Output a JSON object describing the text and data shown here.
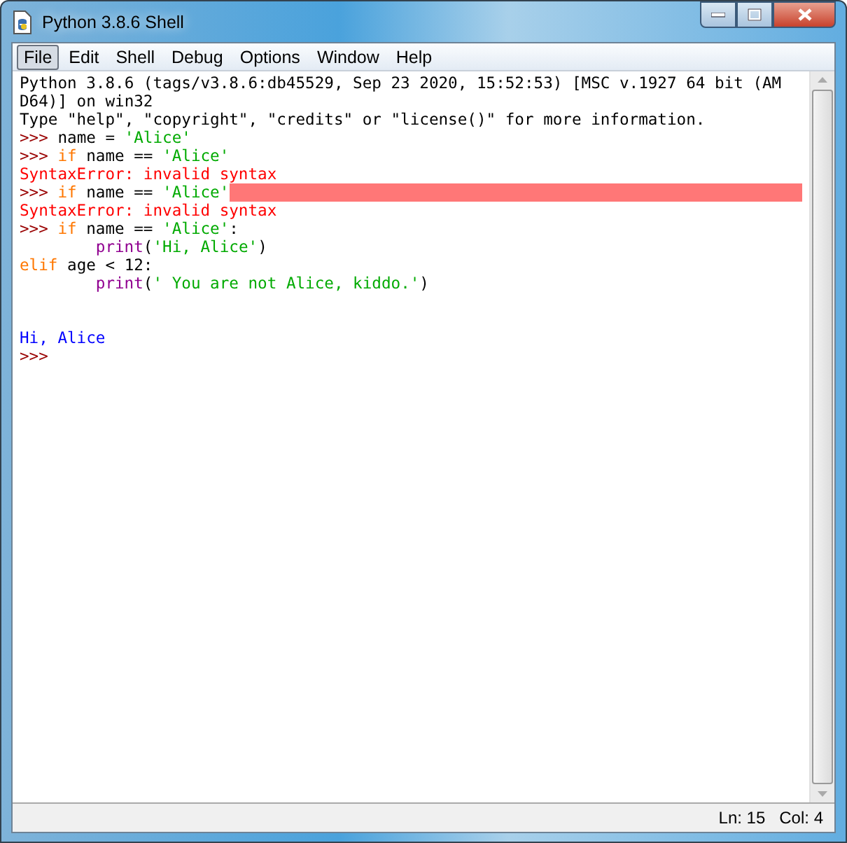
{
  "window": {
    "title": "Python 3.8.6 Shell"
  },
  "menu": [
    {
      "label": "File",
      "selected": true
    },
    {
      "label": "Edit",
      "selected": false
    },
    {
      "label": "Shell",
      "selected": false
    },
    {
      "label": "Debug",
      "selected": false
    },
    {
      "label": "Options",
      "selected": false
    },
    {
      "label": "Window",
      "selected": false
    },
    {
      "label": "Help",
      "selected": false
    }
  ],
  "lines": [
    {
      "segments": [
        {
          "kind": "plain",
          "text": "Python 3.8.6 (tags/v3.8.6:db45529, Sep 23 2020, 15:52:53) [MSC v.1927 64 bit (AM"
        }
      ]
    },
    {
      "segments": [
        {
          "kind": "plain",
          "text": "D64)] on win32"
        }
      ]
    },
    {
      "segments": [
        {
          "kind": "plain",
          "text": "Type \"help\", \"copyright\", \"credits\" or \"license()\" for more information."
        }
      ]
    },
    {
      "segments": [
        {
          "kind": "prompt",
          "text": ">>> "
        },
        {
          "kind": "plain",
          "text": "name = "
        },
        {
          "kind": "string",
          "text": "'Alice'"
        }
      ]
    },
    {
      "segments": [
        {
          "kind": "prompt",
          "text": ">>> "
        },
        {
          "kind": "keyword",
          "text": "if"
        },
        {
          "kind": "plain",
          "text": " name == "
        },
        {
          "kind": "string",
          "text": "'Alice'"
        }
      ]
    },
    {
      "segments": [
        {
          "kind": "error",
          "text": "SyntaxError: invalid syntax"
        }
      ]
    },
    {
      "segments": [
        {
          "kind": "prompt",
          "text": ">>> "
        },
        {
          "kind": "keyword",
          "text": "if"
        },
        {
          "kind": "plain",
          "text": " name == "
        },
        {
          "kind": "string",
          "text": "'Alice'"
        }
      ],
      "error_mark": true
    },
    {
      "segments": [
        {
          "kind": "error",
          "text": "SyntaxError: invalid syntax"
        }
      ]
    },
    {
      "segments": [
        {
          "kind": "prompt",
          "text": ">>> "
        },
        {
          "kind": "keyword",
          "text": "if"
        },
        {
          "kind": "plain",
          "text": " name == "
        },
        {
          "kind": "string",
          "text": "'Alice'"
        },
        {
          "kind": "plain",
          "text": ":"
        }
      ]
    },
    {
      "indented": true,
      "segments": [
        {
          "kind": "builtin",
          "text": "print"
        },
        {
          "kind": "plain",
          "text": "("
        },
        {
          "kind": "string",
          "text": "'Hi, Alice'"
        },
        {
          "kind": "plain",
          "text": ")"
        }
      ]
    },
    {
      "segments": [
        {
          "kind": "keyword",
          "text": "elif"
        },
        {
          "kind": "plain",
          "text": " age < 12:"
        }
      ]
    },
    {
      "indented": true,
      "segments": [
        {
          "kind": "builtin",
          "text": "print"
        },
        {
          "kind": "plain",
          "text": "("
        },
        {
          "kind": "string",
          "text": "' You are not Alice, kiddo.'"
        },
        {
          "kind": "plain",
          "text": ")"
        }
      ]
    },
    {
      "blank": true
    },
    {
      "blank": true
    },
    {
      "segments": [
        {
          "kind": "output",
          "text": "Hi, Alice"
        }
      ]
    },
    {
      "segments": [
        {
          "kind": "prompt",
          "text": ">>>"
        }
      ]
    }
  ],
  "status_bar": {
    "line": "Ln: 15",
    "column": "Col: 4"
  }
}
